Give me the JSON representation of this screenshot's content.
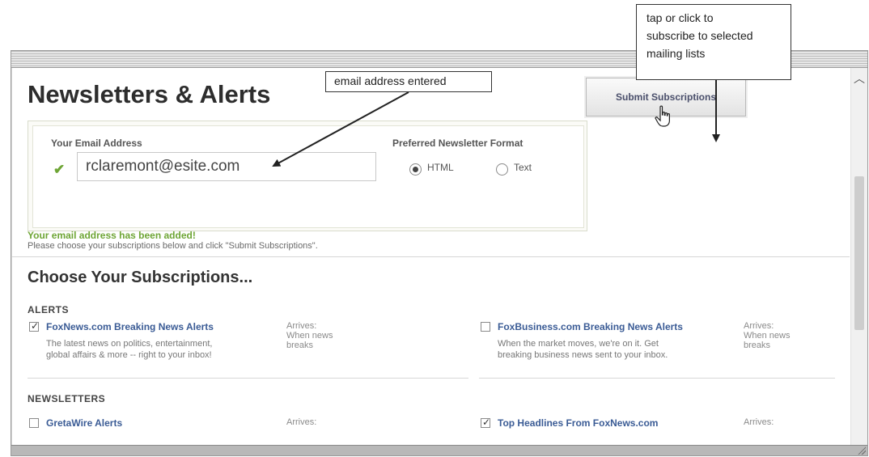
{
  "page": {
    "title": "Newsletters & Alerts"
  },
  "email_form": {
    "label": "Your Email Address",
    "value": "rclaremont@esite.com",
    "format_label": "Preferred Newsletter Format",
    "formats": [
      "HTML",
      "Text"
    ],
    "selected_format": "HTML",
    "submit_label": "Submit Subscriptions",
    "success_message": "Your email address has been added!",
    "instructions": "Please choose your subscriptions below and click \"Submit Subscriptions\"."
  },
  "subscriptions": {
    "title": "Choose Your Subscriptions...",
    "alerts_label": "ALERTS",
    "alerts": [
      {
        "title": "FoxNews.com Breaking News Alerts",
        "desc1": "The latest news on politics, entertainment,",
        "desc2": "global affairs & more -- right to your inbox!",
        "arrives1": "Arrives:",
        "arrives2": "When news",
        "arrives3": "breaks",
        "checked": true
      },
      {
        "title": "FoxBusiness.com Breaking News Alerts",
        "desc1": "When the market moves, we're on it. Get",
        "desc2": "breaking business news sent to your inbox.",
        "arrives1": "Arrives:",
        "arrives2": "When news",
        "arrives3": "breaks",
        "checked": false
      }
    ],
    "newsletters_label": "NEWSLETTERS",
    "newsletters": [
      {
        "title": "GretaWire Alerts",
        "arrives1": "Arrives:",
        "checked": false
      },
      {
        "title": "Top Headlines From FoxNews.com",
        "arrives1": "Arrives:",
        "checked": true
      }
    ]
  },
  "callouts": {
    "email": "email address entered",
    "submit_line1": "tap or click to",
    "submit_line2": "subscribe to selected",
    "submit_line3": "mailing lists"
  },
  "icons": {
    "check": "green-checkmark-icon",
    "cursor": "hand-pointer-icon",
    "scroll": "scroll-up-icon"
  },
  "colors": {
    "accent_green": "#6ea535",
    "link_blue": "#3a5b95"
  }
}
